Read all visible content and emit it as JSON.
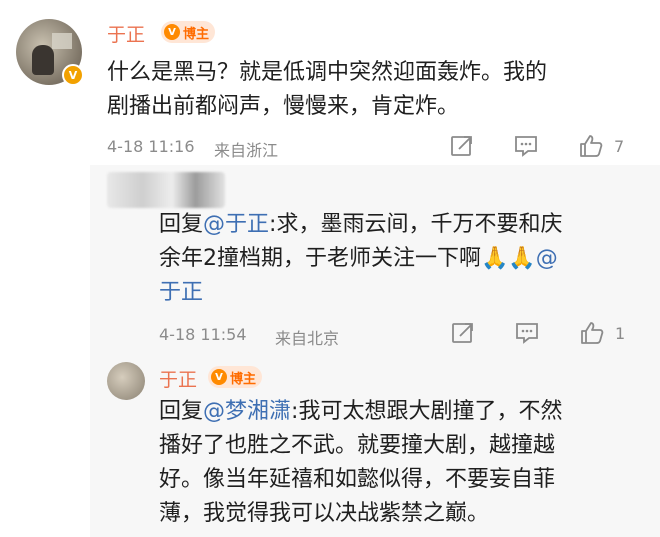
{
  "post": {
    "author": "于正",
    "tag": "博主",
    "tag_icon_glyph": "V",
    "verified_glyph": "V",
    "text_line1": "什么是黑马？就是低调中突然迎面轰炸。我的",
    "text_line2": "剧播出前都闷声，慢慢来，肯定炸。",
    "time": "4-18 11:16",
    "location": "来自浙江",
    "like_count": "7"
  },
  "reply1": {
    "prefix": "回复",
    "mention": "@于正",
    "line1_rest": ":求，墨雨云间，千万不要和庆",
    "line2": "余年2撞档期，于老师关注一下啊",
    "emoji": "🙏🙏",
    "mention2_at": "@",
    "line3": "于正",
    "time": "4-18 11:54",
    "location": "来自北京",
    "like_count": "1"
  },
  "reply2": {
    "author": "于正",
    "tag": "博主",
    "tag_icon_glyph": "V",
    "prefix": "回复",
    "mention": "@梦湘潇",
    "line1_rest": ":我可太想跟大剧撞了，不然",
    "line2": "播好了也胜之不武。就要撞大剧，越撞越",
    "line3": "好。像当年延禧和如懿似得，不要妄自菲",
    "line4": "薄，我觉得我可以决战紫禁之巅。"
  },
  "colors": {
    "name": "#eb7350",
    "link": "#3e6fb3",
    "meta": "#8b8b8b",
    "tag_bg": "#ffe6d6",
    "tag_text": "#ff6c00",
    "reply_bg": "#f7f7f7"
  },
  "icons": [
    "share-icon",
    "comment-icon",
    "like-icon",
    "verified-badge-icon"
  ]
}
